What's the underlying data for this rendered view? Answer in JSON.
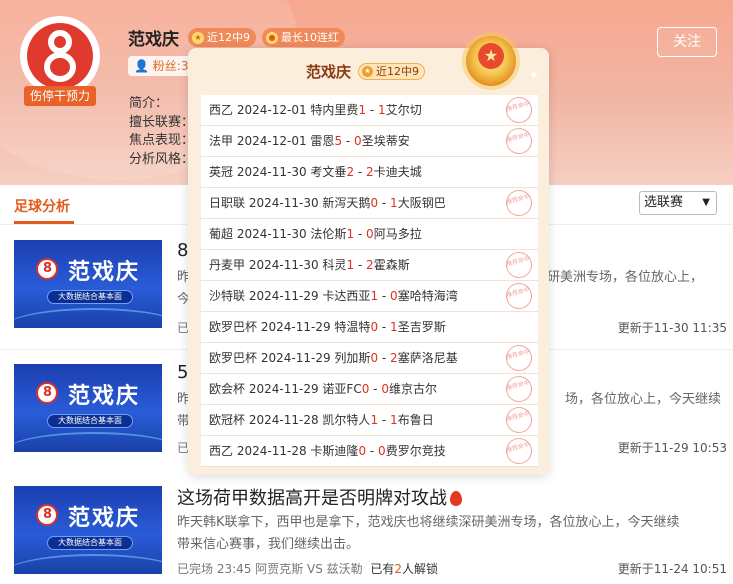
{
  "expert": {
    "name": "范戏庆",
    "badge_recent": "近12中9",
    "badge_streak": "最长10连红",
    "avatar_tag": "伤停干预力",
    "fans_label": "粉丝:3",
    "follow_label": "关注",
    "profile_rows": [
      "简介：",
      "擅长联赛：",
      "焦点表现：",
      "分析风格："
    ]
  },
  "tabs": {
    "active": "足球分析",
    "league_select": "选联赛"
  },
  "articles": [
    {
      "thumb_title": "范戏庆",
      "thumb_sub": "大数据结合基本面",
      "title": "8/",
      "desc_line1": "昨",
      "desc_line1_right": "研美洲专场，各位放心上，",
      "desc_line2": "今",
      "meta": "已",
      "time": "更新于11-30 11:35"
    },
    {
      "thumb_title": "范戏庆",
      "thumb_sub": "大数据结合基本面",
      "title": "5/",
      "desc_line1": "昨",
      "desc_line1_right": "场，各位放心上，今天继续",
      "desc_line2": "带",
      "meta": "已",
      "time": "更新于11-29 10:53"
    },
    {
      "thumb_title": "范戏庆",
      "thumb_sub": "大数据结合基本面",
      "title": "这场荷甲数据高开是否明牌对攻战",
      "desc_line1": "昨天韩K联拿下，西甲也是拿下，范戏庆也将继续深研美洲专场，各位放心上，今天继续",
      "desc_line2": "带来信心赛事，我们继续出击。",
      "meta_prefix": "已完场 23:45 阿贾克斯 VS 兹沃勒",
      "meta_unlock_pre": "已有",
      "meta_unlock_num": "2",
      "meta_unlock_post": "人解锁",
      "time": "更新于11-24 10:51"
    }
  ],
  "popup": {
    "name": "范戏庆",
    "badge": "近12中9",
    "stamp_text": "推荐命中",
    "results": [
      {
        "league": "西乙",
        "date": "2024-12-01",
        "home": "特内里费",
        "hs": "1",
        "as": "1",
        "away": "艾尔切",
        "hit": true
      },
      {
        "league": "法甲",
        "date": "2024-12-01",
        "home": "雷恩",
        "hs": "5",
        "as": "0",
        "away": "圣埃蒂安",
        "hit": true
      },
      {
        "league": "英冠",
        "date": "2024-11-30",
        "home": "考文垂",
        "hs": "2",
        "as": "2",
        "away": "卡迪夫城",
        "hit": false
      },
      {
        "league": "日职联",
        "date": "2024-11-30",
        "home": "新泻天鹅",
        "hs": "0",
        "as": "1",
        "away": "大阪钢巴",
        "hit": true
      },
      {
        "league": "葡超",
        "date": "2024-11-30",
        "home": "法伦斯",
        "hs": "1",
        "as": "0",
        "away": "阿马多拉",
        "hit": false
      },
      {
        "league": "丹麦甲",
        "date": "2024-11-30",
        "home": "科灵",
        "hs": "1",
        "as": "2",
        "away": "霍森斯",
        "hit": true
      },
      {
        "league": "沙特联",
        "date": "2024-11-29",
        "home": "卡达西亚",
        "hs": "1",
        "as": "0",
        "away": "塞哈特海湾",
        "hit": true
      },
      {
        "league": "欧罗巴杯",
        "date": "2024-11-29",
        "home": "特温特",
        "hs": "0",
        "as": "1",
        "away": "圣吉罗斯",
        "hit": false
      },
      {
        "league": "欧罗巴杯",
        "date": "2024-11-29",
        "home": "列加斯",
        "hs": "0",
        "as": "2",
        "away": "塞萨洛尼基",
        "hit": true
      },
      {
        "league": "欧会杯",
        "date": "2024-11-29",
        "home": "诺亚FC",
        "hs": "0",
        "as": "0",
        "away": "维京古尔",
        "hit": true
      },
      {
        "league": "欧冠杯",
        "date": "2024-11-28",
        "home": "凯尔特人",
        "hs": "1",
        "as": "1",
        "away": "布鲁日",
        "hit": true
      },
      {
        "league": "西乙",
        "date": "2024-11-28",
        "home": "卡斯迪隆",
        "hs": "0",
        "as": "0",
        "away": "费罗尔竞技",
        "hit": true
      }
    ]
  },
  "colors": {
    "accent": "#e35a1c",
    "score": "#e0301e",
    "popup_bg": "#fbeedd"
  }
}
